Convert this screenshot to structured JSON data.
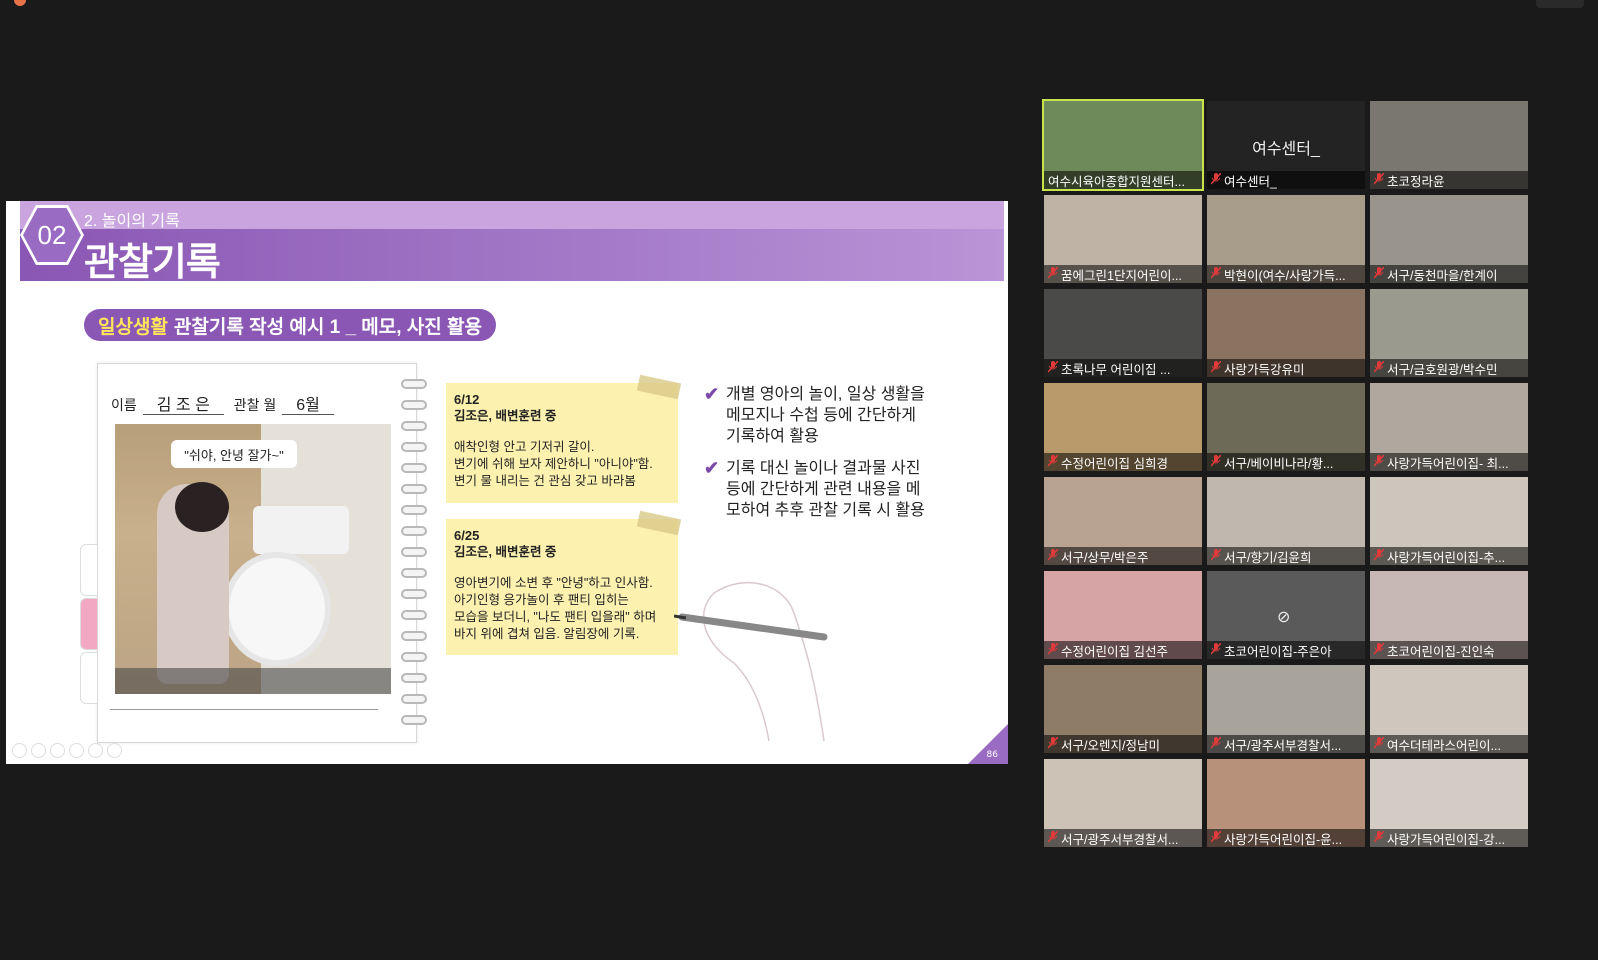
{
  "slide": {
    "section_num": "02",
    "section_label": "2. 놀이의 기록",
    "title": "관찰기록",
    "pill_highlight": "일상생활",
    "pill_rest": "관찰기록 작성 예시 1 _ 메모, 사진 활용",
    "name_label": "이름",
    "name_value": "김 조 은",
    "month_label": "관찰 월",
    "month_value": "6월",
    "speech_bubble": "\"쉬야, 안녕 잘가~\"",
    "note1": {
      "date": "6/12",
      "head": "김조은, 배변훈련 중",
      "l1": "애착인형 안고 기저귀 갈이.",
      "l2": "변기에 쉬해 보자 제안하니 \"아니야\"함.",
      "l3": "변기 물 내리는 건 관심 갖고 바라봄"
    },
    "note2": {
      "date": "6/25",
      "head": "김조은, 배변훈련 중",
      "l1": "영아변기에 소변 후 \"안녕\"하고 인사함.",
      "l2": "아기인형 응가놀이 후 팬티 입히는",
      "l3": "모습을 보더니, \"나도 팬티 입을래\" 하며",
      "l4": "바지 위에 겹쳐 입음. 알림장에 기록."
    },
    "bullet1": "개별 영아의 놀이, 일상 생활을 메모지나 수첩 등에 간단하게 기록하여 활용",
    "bullet2": "기록 대신 놀이나 결과물 사진 등에 간단하게 관련 내용을 메모하여 추후 관찰 기록 시 활용",
    "page_number": "86"
  },
  "participants": [
    {
      "name": "여수시육아종합지원센터...",
      "camera_label": "",
      "muted": false,
      "active": true,
      "bg": "#6f8a5a"
    },
    {
      "name": "여수센터_",
      "camera_label": "여수센터_",
      "muted": true,
      "active": false,
      "bg": "#232323"
    },
    {
      "name": "초코정라윤",
      "camera_label": "",
      "muted": true,
      "active": false,
      "bg": "#7a7670"
    },
    {
      "name": "꿈에그린1단지어린이...",
      "camera_label": "",
      "muted": true,
      "active": false,
      "bg": "#bfb3a6"
    },
    {
      "name": "박현이(여수/사랑가득...",
      "camera_label": "",
      "muted": true,
      "active": false,
      "bg": "#a89c8a"
    },
    {
      "name": "서구/동천마을/한계이",
      "camera_label": "",
      "muted": true,
      "active": false,
      "bg": "#9a958c"
    },
    {
      "name": "초록나무 어린이집 ...",
      "camera_label": "",
      "muted": true,
      "active": false,
      "bg": "#4a4a48"
    },
    {
      "name": "사랑가득강유미",
      "camera_label": "",
      "muted": true,
      "active": false,
      "bg": "#8a7360"
    },
    {
      "name": "서구/금호원광/박수민",
      "camera_label": "",
      "muted": true,
      "active": false,
      "bg": "#9b9a8f"
    },
    {
      "name": "수정어린이집 심희경",
      "camera_label": "",
      "muted": true,
      "active": false,
      "bg": "#b99a6a"
    },
    {
      "name": "서구/베이비나라/황...",
      "camera_label": "",
      "muted": true,
      "active": false,
      "bg": "#6e6a58"
    },
    {
      "name": "사랑가득어린이집- 최...",
      "camera_label": "",
      "muted": true,
      "active": false,
      "bg": "#b0a89e"
    },
    {
      "name": "서구/상무/박은주",
      "camera_label": "",
      "muted": true,
      "active": false,
      "bg": "#b8a392"
    },
    {
      "name": "서구/향기/김윤희",
      "camera_label": "",
      "muted": true,
      "active": false,
      "bg": "#c0b8ae"
    },
    {
      "name": "사랑가득어린이집-추...",
      "camera_label": "",
      "muted": true,
      "active": false,
      "bg": "#cdc6bd"
    },
    {
      "name": "수정어린이집 김선주",
      "camera_label": "",
      "muted": true,
      "active": false,
      "bg": "#d7a4a6"
    },
    {
      "name": "초코어린이집-주은아",
      "camera_label": "",
      "muted": true,
      "active": false,
      "bg": "#5a5a5a"
    },
    {
      "name": "초코어린이집-진인숙",
      "camera_label": "",
      "muted": true,
      "active": false,
      "bg": "#c7b8b6"
    },
    {
      "name": "서구/오렌지/정남미",
      "camera_label": "",
      "muted": true,
      "active": false,
      "bg": "#8f7c66"
    },
    {
      "name": "서구/광주서부경찰서...",
      "camera_label": "",
      "muted": true,
      "active": false,
      "bg": "#a9a49b"
    },
    {
      "name": "여수더테라스어린이...",
      "camera_label": "",
      "muted": true,
      "active": false,
      "bg": "#cfc6bd"
    },
    {
      "name": "서구/광주서부경찰서...",
      "camera_label": "",
      "muted": true,
      "active": false,
      "bg": "#cdc2b6"
    },
    {
      "name": "사랑가득어린이집-윤...",
      "camera_label": "",
      "muted": true,
      "active": false,
      "bg": "#b8917a"
    },
    {
      "name": "사랑가득어린이집-강...",
      "camera_label": "",
      "muted": true,
      "active": false,
      "bg": "#d2ccc4"
    }
  ],
  "icons": {
    "mic_muted": "mic-muted-icon",
    "camera_off": "camera-off-icon",
    "check": "check-icon"
  },
  "colors": {
    "accent_purple": "#8a57b4",
    "highlight_yellow": "#ffe55c",
    "active_speaker": "#c9e34a",
    "muted_red": "#e03a3a"
  }
}
